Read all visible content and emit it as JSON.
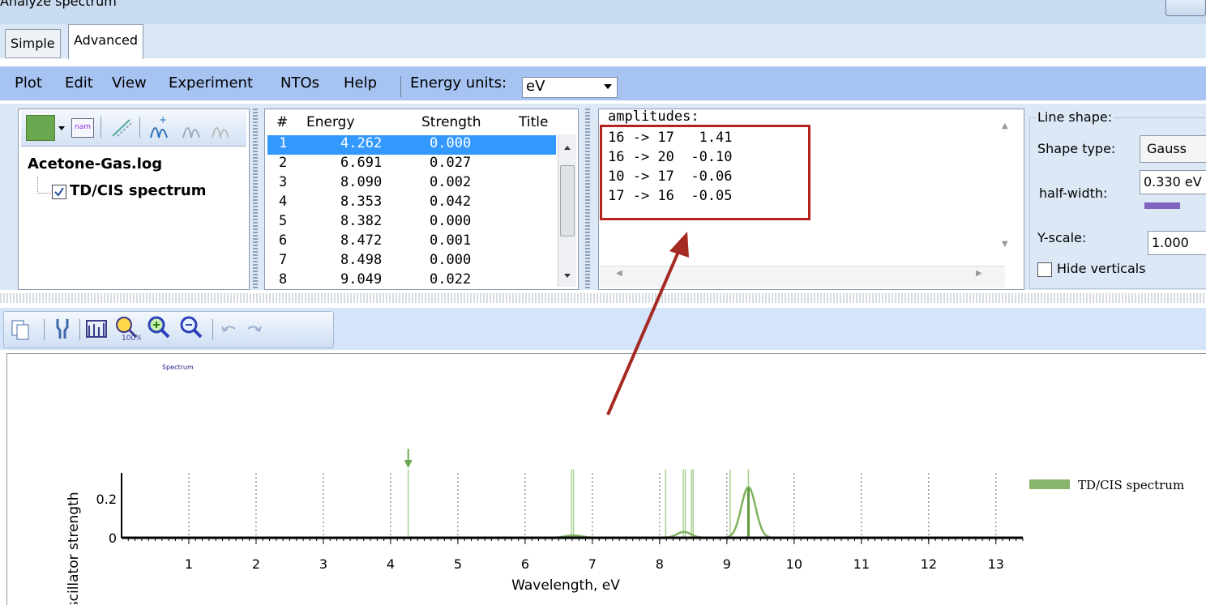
{
  "window": {
    "title": "Analyze spectrum"
  },
  "tabs": [
    {
      "label": "Simple"
    },
    {
      "label": "Advanced"
    }
  ],
  "menu": {
    "items": [
      "Plot",
      "Edit",
      "View",
      "Experiment",
      "NTOs",
      "Help"
    ],
    "energy_units_label": "Energy units:",
    "energy_units_value": "eV"
  },
  "tree": {
    "file": "Acetone-Gas.log",
    "child": "TD/CIS spectrum",
    "child_checked": true
  },
  "transitions": {
    "headers": [
      "#",
      "Energy",
      "Strength",
      "Title"
    ],
    "rows": [
      {
        "n": "1",
        "energy": "4.262",
        "strength": "0.000"
      },
      {
        "n": "2",
        "energy": "6.691",
        "strength": "0.027"
      },
      {
        "n": "3",
        "energy": "8.090",
        "strength": "0.002"
      },
      {
        "n": "4",
        "energy": "8.353",
        "strength": "0.042"
      },
      {
        "n": "5",
        "energy": "8.382",
        "strength": "0.000"
      },
      {
        "n": "6",
        "energy": "8.472",
        "strength": "0.001"
      },
      {
        "n": "7",
        "energy": "8.498",
        "strength": "0.000"
      },
      {
        "n": "8",
        "energy": "9.049",
        "strength": "0.022"
      }
    ],
    "selected_index": 0
  },
  "amplitudes": {
    "header": "amplitudes:",
    "lines": [
      "16 -> 17   1.41",
      "16 -> 20  -0.10",
      "10 -> 17  -0.06",
      "17 -> 16  -0.05"
    ]
  },
  "line_shape": {
    "group_label": "Line shape:",
    "shape_type_label": "Shape type:",
    "shape_type_value": "Gauss",
    "half_width_label": "half-width:",
    "half_width_value": "0.330 eV",
    "yscale_label": "Y-scale:",
    "yscale_value": "1.000",
    "hide_verticals_label": "Hide verticals",
    "hide_verticals_checked": false
  },
  "colors": {
    "annotation_box": "#b3221c",
    "arrow": "#a52a22",
    "series": "#88b46c",
    "selection": "#3399ff",
    "menubar": "#a7c3f2"
  },
  "chart_data": {
    "type": "line",
    "title": "Spectrum",
    "xlabel": "Wavelength, eV",
    "ylabel": "Oscillator strength",
    "xlim": [
      0,
      13.4
    ],
    "ylim": [
      0,
      0.34
    ],
    "x_ticks": [
      "1",
      "2",
      "3",
      "4",
      "5",
      "6",
      "7",
      "8",
      "9",
      "10",
      "11",
      "12",
      "13"
    ],
    "y_ticks": [
      "0",
      "0.2"
    ],
    "legend": {
      "position": "right",
      "entries": [
        "TD/CIS spectrum"
      ]
    },
    "grid": "vertical dotted",
    "series": [
      {
        "name": "TD/CIS spectrum",
        "sticks": [
          {
            "x": 4.262,
            "y": 0.35
          },
          {
            "x": 6.691,
            "y": 0.35
          },
          {
            "x": 6.72,
            "y": 0.35
          },
          {
            "x": 8.09,
            "y": 0.35
          },
          {
            "x": 8.353,
            "y": 0.35
          },
          {
            "x": 8.382,
            "y": 0.35
          },
          {
            "x": 8.472,
            "y": 0.35
          },
          {
            "x": 8.498,
            "y": 0.35
          },
          {
            "x": 9.049,
            "y": 0.35
          },
          {
            "x": 9.32,
            "y": 0.35
          }
        ],
        "main_stick": {
          "x": 9.32,
          "y": 0.255
        },
        "peaks": [
          {
            "center": 6.72,
            "height": 0.012,
            "width": 0.18
          },
          {
            "center": 8.36,
            "height": 0.03,
            "width": 0.15
          },
          {
            "center": 9.32,
            "height": 0.26,
            "width": 0.15
          }
        ]
      }
    ],
    "marker_arrow_x": 4.262
  }
}
